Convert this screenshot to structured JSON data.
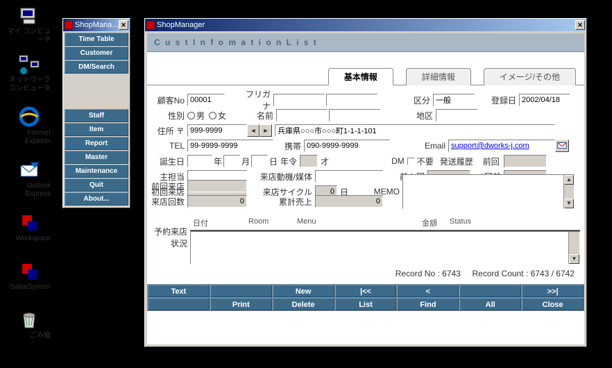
{
  "desktop": {
    "icons": [
      {
        "label": "マイ コンピュータ"
      },
      {
        "label": "ネットワーク\nコンピュータ"
      },
      {
        "label": "Internet\nExplorer"
      },
      {
        "label": "Outlook\nExpress"
      },
      {
        "label": "Workspace"
      },
      {
        "label": "SalonSystem"
      },
      {
        "label": "ごみ箱"
      }
    ]
  },
  "menu_window": {
    "title": "ShopMana...",
    "items_a": [
      "Time Table",
      "Customer",
      "DM/Search"
    ],
    "items_b": [
      "Staff",
      "Item",
      "Report",
      "Master",
      "Maintenance",
      "Quit",
      "About..."
    ]
  },
  "main_window": {
    "title": "ShopManager",
    "panel_title": "C u s t  I n f o m a t i o n  L i s t",
    "tabs": [
      "基本情報",
      "詳細情報",
      "イメージ/その他"
    ],
    "active_tab": 0,
    "labels": {
      "cust_no": "顧客No",
      "furigana": "フリガナ",
      "kubun": "区分",
      "toroku": "登録日",
      "seibetsu": "性別",
      "male": "男",
      "female": "女",
      "namae": "名前",
      "chiku": "地区",
      "jusho": "住所 〒",
      "tel": "TEL",
      "keitai": "携帯",
      "email": "Email",
      "tanjobi": "誕生日",
      "nen": "年",
      "tsuki": "月",
      "hi": "日",
      "nenrei": "年令",
      "sai": "才",
      "dm": "DM",
      "fuyo": "不要",
      "haso": "発送履歴",
      "zenkai": "前回",
      "shutanto": "主担当",
      "raiten_doki": "来店動機/媒体",
      "maemae": "前々回",
      "sankai": "3回前",
      "shokai": "初回来店",
      "cycle": "来店サイクル",
      "nichi": "日",
      "memo": "MEMO",
      "zenkai_raiten": "前回来店",
      "kaisu": "来店回数",
      "ruikei": "累計売上",
      "yoyaku": "予約来店\n状況",
      "g_date": "日付",
      "g_room": "Room",
      "g_menu": "Menu",
      "g_amount": "金額",
      "g_status": "Status"
    },
    "values": {
      "cust_no": "00001",
      "kubun": "一般",
      "toroku": "2002/04/18",
      "zip": "999-9999",
      "address": "兵庫県○○○市○○○町1-1-1-101",
      "tel": "99-9999-9999",
      "keitai": "090-9999-9999",
      "email": "support@dworks-j.com",
      "cycle": "0",
      "kaisu": "0",
      "ruikei": "0"
    },
    "status": {
      "record_no_label": "Record No :",
      "record_no": "6743",
      "record_count_label": "Record Count :",
      "record_count_a": "6743",
      "record_count_b": "6742"
    },
    "bottom": {
      "r1": [
        "Text",
        "",
        "New",
        "|<<",
        "<",
        "",
        ">>|"
      ],
      "r2": [
        "",
        "Print",
        "Delete",
        "List",
        "Find",
        "All",
        "Close"
      ]
    }
  }
}
